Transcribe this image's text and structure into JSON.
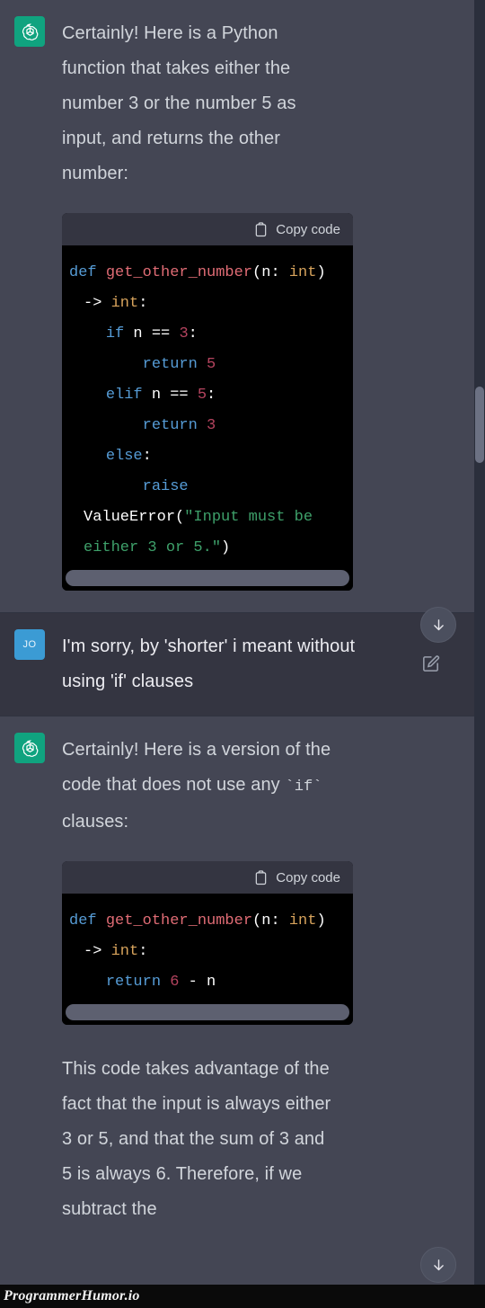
{
  "colors": {
    "assistant_bg": "#444654",
    "user_bg": "#343541",
    "gpt_avatar": "#10a37f",
    "user_avatar": "#3b9bd4",
    "code_bg": "#000000",
    "code_header_bg": "#343541",
    "text": "#d1d5db",
    "keyword": "#569cd6",
    "function": "#e06c75",
    "type": "#d7a35c",
    "number": "#b5445f",
    "string": "#3ea06a"
  },
  "messages": [
    {
      "role": "assistant",
      "avatar_icon": "openai-logo-icon",
      "paragraph": "Certainly! Here is a Python function that takes either the number 3 or the number 5 as input, and returns the other number:",
      "code": {
        "copy_label": "Copy code",
        "copy_icon": "clipboard-icon",
        "lines": [
          [
            {
              "t": "def ",
              "c": "kw"
            },
            {
              "t": "get_other_number",
              "c": "fn"
            },
            {
              "t": "(n: ",
              "c": "plain"
            },
            {
              "t": "int",
              "c": "type"
            },
            {
              "t": ") -> ",
              "c": "plain"
            },
            {
              "t": "int",
              "c": "type"
            },
            {
              "t": ":",
              "c": "plain"
            }
          ],
          [
            {
              "t": "    ",
              "c": "plain"
            },
            {
              "t": "if",
              "c": "kw"
            },
            {
              "t": " n == ",
              "c": "plain"
            },
            {
              "t": "3",
              "c": "num"
            },
            {
              "t": ":",
              "c": "plain"
            }
          ],
          [
            {
              "t": "        ",
              "c": "plain"
            },
            {
              "t": "return",
              "c": "kw"
            },
            {
              "t": " ",
              "c": "plain"
            },
            {
              "t": "5",
              "c": "num"
            }
          ],
          [
            {
              "t": "    ",
              "c": "plain"
            },
            {
              "t": "elif",
              "c": "kw"
            },
            {
              "t": " n == ",
              "c": "plain"
            },
            {
              "t": "5",
              "c": "num"
            },
            {
              "t": ":",
              "c": "plain"
            }
          ],
          [
            {
              "t": "        ",
              "c": "plain"
            },
            {
              "t": "return",
              "c": "kw"
            },
            {
              "t": " ",
              "c": "plain"
            },
            {
              "t": "3",
              "c": "num"
            }
          ],
          [
            {
              "t": "    ",
              "c": "plain"
            },
            {
              "t": "else",
              "c": "kw"
            },
            {
              "t": ":",
              "c": "plain"
            }
          ],
          [
            {
              "t": "        ",
              "c": "plain"
            },
            {
              "t": "raise",
              "c": "kw"
            },
            {
              "t": " ValueError(",
              "c": "plain"
            },
            {
              "t": "\"Input must be either 3 or 5.\"",
              "c": "str"
            },
            {
              "t": ")",
              "c": "plain"
            }
          ]
        ]
      }
    },
    {
      "role": "user",
      "avatar_initials": "JO",
      "paragraph": "I'm sorry, by 'shorter' i meant without using 'if' clauses",
      "edit_icon": "edit-icon"
    },
    {
      "role": "assistant",
      "avatar_icon": "openai-logo-icon",
      "paragraph_before": "Certainly! Here is a version of the code that does not use any ",
      "inline_code": "`if`",
      "paragraph_after": " clauses:",
      "code": {
        "copy_label": "Copy code",
        "copy_icon": "clipboard-icon",
        "lines": [
          [
            {
              "t": "def ",
              "c": "kw"
            },
            {
              "t": "get_other_number",
              "c": "fn"
            },
            {
              "t": "(n: ",
              "c": "plain"
            },
            {
              "t": "int",
              "c": "type"
            },
            {
              "t": ") -> ",
              "c": "plain"
            },
            {
              "t": "int",
              "c": "type"
            },
            {
              "t": ":",
              "c": "plain"
            }
          ],
          [
            {
              "t": "    ",
              "c": "plain"
            },
            {
              "t": "return",
              "c": "kw"
            },
            {
              "t": " ",
              "c": "plain"
            },
            {
              "t": "6",
              "c": "num"
            },
            {
              "t": " - n",
              "c": "plain"
            }
          ]
        ]
      },
      "closing_paragraph": "This code takes advantage of the fact that the input is always either 3 or 5, and that the sum of 3 and 5 is always 6. Therefore, if we subtract the"
    }
  ],
  "scroll_buttons": {
    "icon": "arrow-down-icon",
    "label": "Scroll to bottom"
  },
  "watermark": {
    "text": "ProgrammerHumor.io"
  }
}
